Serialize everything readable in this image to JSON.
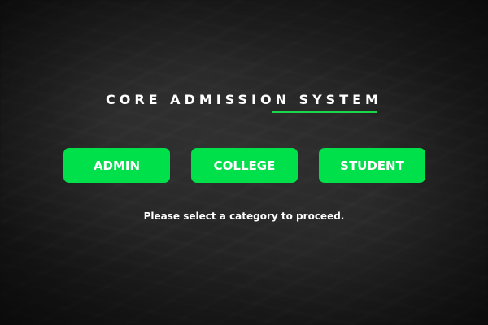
{
  "header": {
    "title": "CORE ADMISSION SYSTEM"
  },
  "categories": [
    {
      "label": "ADMIN"
    },
    {
      "label": "COLLEGE"
    },
    {
      "label": "STUDENT"
    }
  ],
  "instructions": {
    "text": "Please select a category to proceed."
  },
  "colors": {
    "accent": "#00e04b",
    "underline": "#19d94a",
    "background": "#232323",
    "text": "#ffffff"
  }
}
